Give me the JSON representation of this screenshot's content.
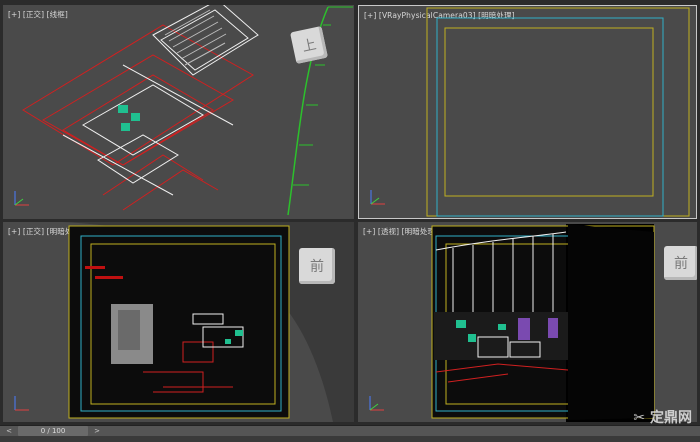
{
  "viewports": {
    "top_left": {
      "label": "[+] [正交] [线框]",
      "cube_face": "上"
    },
    "top_right": {
      "label": "[+] [VRayPhysicalCamera03] [明暗处理]"
    },
    "bottom_left": {
      "label": "[+] [正交] [明暗处理]",
      "cube_face": "前"
    },
    "bottom_right": {
      "label": "[+] [透视] [明暗处理 + 边面]",
      "cube_face": "前"
    }
  },
  "timeline": {
    "prev": "<",
    "frame_text": "0 / 100",
    "next": ">"
  },
  "watermark": {
    "text": "定鼎网"
  }
}
